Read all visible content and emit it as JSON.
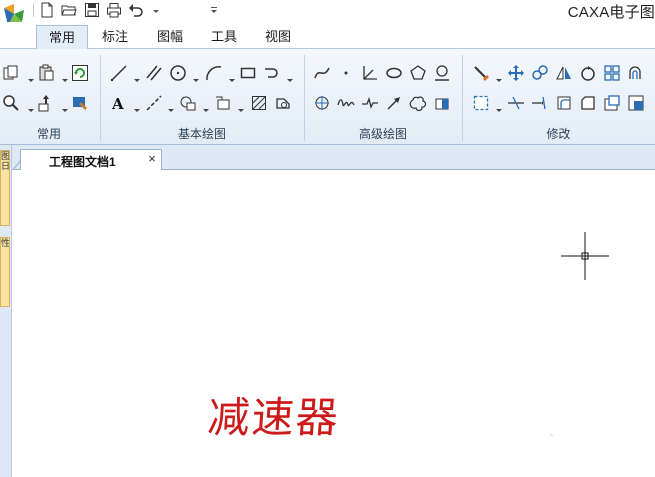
{
  "app": {
    "title": "CAXA电子图"
  },
  "quick_access": [
    {
      "name": "new-file-icon"
    },
    {
      "name": "open-folder-icon"
    },
    {
      "name": "save-icon"
    },
    {
      "name": "print-icon"
    },
    {
      "name": "undo-icon"
    },
    {
      "name": "customize-dropdown-icon"
    }
  ],
  "ribbon": {
    "tabs": [
      {
        "label": "常用",
        "active": true
      },
      {
        "label": "标注",
        "active": false
      },
      {
        "label": "图幅",
        "active": false
      },
      {
        "label": "工具",
        "active": false
      },
      {
        "label": "视图",
        "active": false
      }
    ],
    "groups": [
      {
        "label": "常用"
      },
      {
        "label": "基本绘图"
      },
      {
        "label": "高级绘图"
      },
      {
        "label": "修改"
      }
    ]
  },
  "side_panels": [
    {
      "label": "图日"
    },
    {
      "label": "性"
    }
  ],
  "document": {
    "tab_label": "工程图文档1",
    "close_glyph": "×"
  },
  "drawing": {
    "text": "减速器",
    "text_color": "#cc1a1a"
  },
  "colors": {
    "ribbon_bg": "#e3ecf6",
    "tab_active_bg": "#e3edf8",
    "icon_blue": "#2b6cb3",
    "side_tab_bg": "#f9e3a5"
  }
}
